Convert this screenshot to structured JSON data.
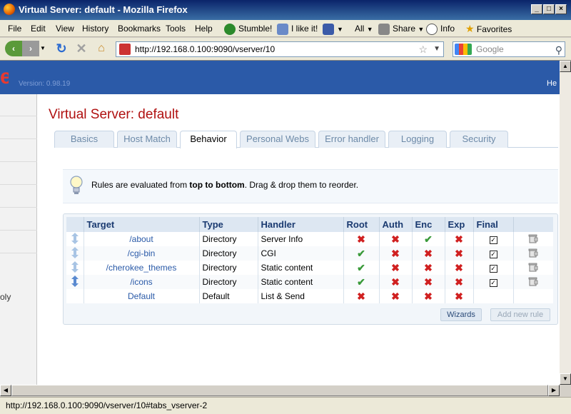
{
  "window": {
    "title": "Virtual Server: default - Mozilla Firefox"
  },
  "menu": [
    "File",
    "Edit",
    "View",
    "History",
    "Bookmarks",
    "Tools",
    "Help"
  ],
  "toolbar": {
    "stumble": "Stumble!",
    "ilike": "I like it!",
    "all": "All",
    "share": "Share",
    "info": "Info",
    "favorites": "Favorites"
  },
  "nav": {
    "url": "http://192.168.0.100:9090/vserver/10",
    "search_placeholder": "Google"
  },
  "header": {
    "version": "Version: 0.98.19",
    "help": "He"
  },
  "sidebar": {
    "partial_text": "oly"
  },
  "page": {
    "title": "Virtual Server: default"
  },
  "tabs": [
    "Basics",
    "Host Match",
    "Behavior",
    "Personal Webs",
    "Error handler",
    "Logging",
    "Security"
  ],
  "active_tab": "Behavior",
  "info": {
    "pre": "Rules are evaluated from ",
    "bold": "top to bottom",
    "post": ". Drag & drop them to reorder."
  },
  "table": {
    "headers": [
      "Target",
      "Type",
      "Handler",
      "Root",
      "Auth",
      "Enc",
      "Exp",
      "Final"
    ],
    "rows": [
      {
        "target": "/about",
        "type": "Directory",
        "handler": "Server Info",
        "root": "✖",
        "auth": "✖",
        "enc": "✔",
        "exp": "✖",
        "final": "✓"
      },
      {
        "target": "/cgi-bin",
        "type": "Directory",
        "handler": "CGI",
        "root": "✔",
        "auth": "✖",
        "enc": "✖",
        "exp": "✖",
        "final": "✓"
      },
      {
        "target": "/cherokee_themes",
        "type": "Directory",
        "handler": "Static content",
        "root": "✔",
        "auth": "✖",
        "enc": "✖",
        "exp": "✖",
        "final": "✓"
      },
      {
        "target": "/icons",
        "type": "Directory",
        "handler": "Static content",
        "root": "✔",
        "auth": "✖",
        "enc": "✖",
        "exp": "✖",
        "final": "✓"
      },
      {
        "target": "Default",
        "type": "Default",
        "handler": "List & Send",
        "root": "✖",
        "auth": "✖",
        "enc": "✖",
        "exp": "✖",
        "final": ""
      }
    ]
  },
  "buttons": {
    "wizards": "Wizards",
    "add_rule": "Add new rule"
  },
  "status": {
    "text": "http://192.168.0.100:9090/vserver/10#tabs_vserver-2"
  },
  "colors": {
    "header": "#2b5aa8",
    "title": "#b01010",
    "cross": "#d02020",
    "check": "#3a9a3a",
    "link": "#2a5aa8"
  }
}
